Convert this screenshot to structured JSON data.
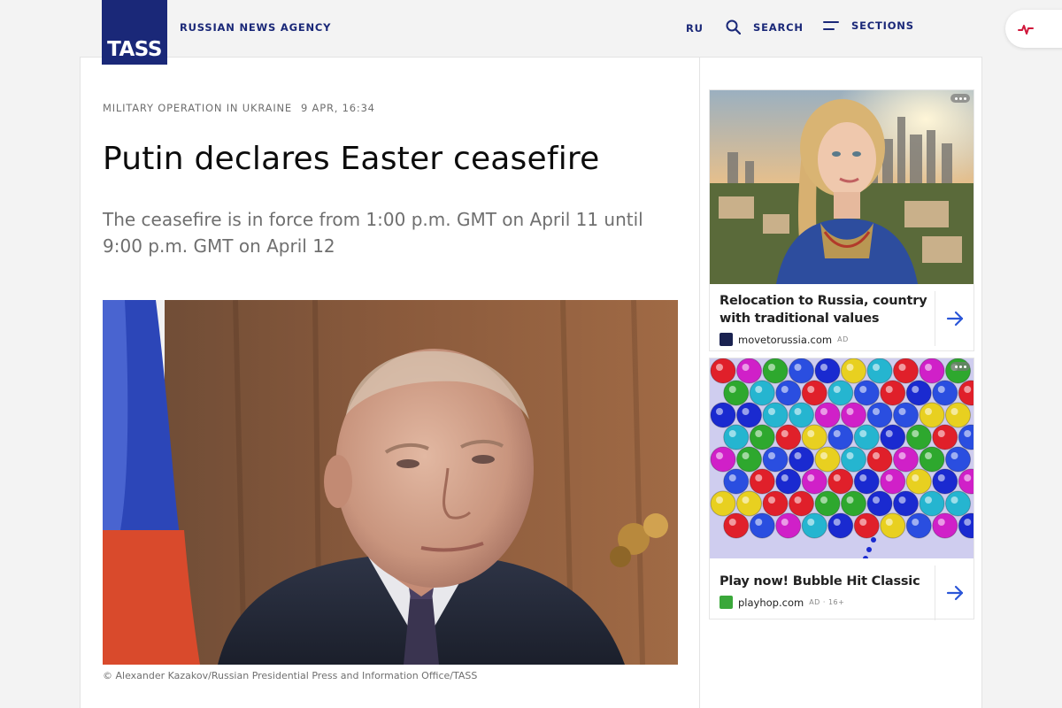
{
  "header": {
    "logo_text": "TASS",
    "agency": "RUSSIAN NEWS AGENCY",
    "lang": "RU",
    "search_label": "SEARCH",
    "sections_label": "SECTIONS",
    "icons": [
      "search-icon",
      "menu-icon",
      "pulse-icon"
    ],
    "brand_color": "#1a2878",
    "pulse_color": "#d0183b"
  },
  "article": {
    "category": "MILITARY OPERATION IN UKRAINE",
    "date": "9 APR, 16:34",
    "title": "Putin declares Easter ceasefire",
    "lead": "The ceasefire is in force from 1:00 p.m. GMT on April 11 until 9:00 p.m. GMT on April 12",
    "photo_credit": "© Alexander Kazakov/Russian Presidential Press and Information Office/TASS"
  },
  "ads": [
    {
      "title": "Relocation to Russia, country with traditional values",
      "source": "movetorussia.com",
      "tag": "AD"
    },
    {
      "title": "Play now! Bubble Hit Classic",
      "source": "playhop.com",
      "tag": "AD · 16+"
    }
  ]
}
